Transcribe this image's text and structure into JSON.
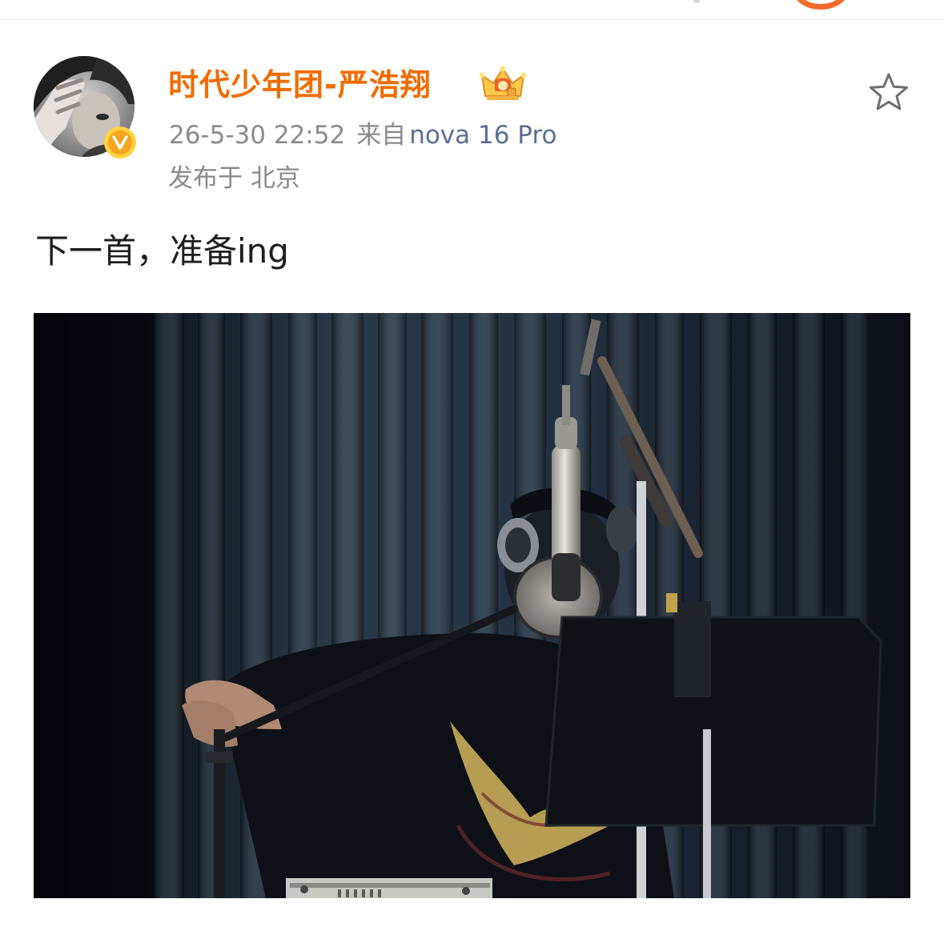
{
  "post": {
    "username": "时代少年团-严浩翔",
    "timestamp": "26-5-30 22:52",
    "source_prefix": "来自",
    "device": "nova 16 Pro",
    "location": "发布于 北京",
    "content": "下一首，准备ing",
    "verified_icon": "verified-v-icon",
    "crown_icon": "member-crown-icon",
    "favorite_icon": "star-outline-icon"
  },
  "colors": {
    "username": "#f06c00",
    "meta": "#8a8a8a",
    "device_link": "#5a6f93",
    "content_text": "#1e1e1e",
    "verified_badge": "#f5a623"
  }
}
